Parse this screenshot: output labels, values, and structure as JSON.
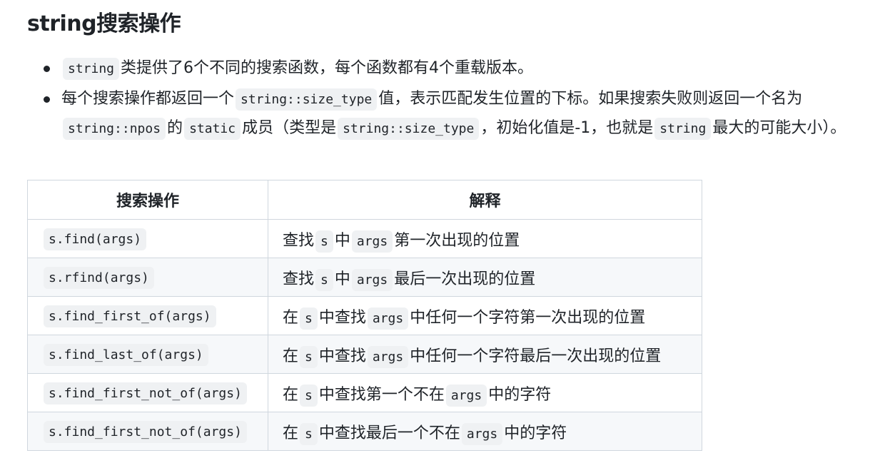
{
  "heading": "string搜索操作",
  "bullets": {
    "b1": {
      "code1": "string",
      "text1": "类提供了6个不同的搜索函数，每个函数都有4个重载版本。"
    },
    "b2": {
      "text1": "每个搜索操作都返回一个",
      "code1": "string::size_type",
      "text2": "值，表示匹配发生位置的下标。如果搜索失败则返回一个名为",
      "code2": "string::npos",
      "text3": "的",
      "code3": "static",
      "text4": "成员（类型是",
      "code4": "string::size_type",
      "text5": "，初始化值是-1，也就是",
      "code5": "string",
      "text6": "最大的可能大小）。"
    }
  },
  "table": {
    "headers": [
      "搜索操作",
      "解释"
    ],
    "rows": [
      {
        "op": "s.find(args)",
        "p1": "查找",
        "c1": "s",
        "p2": "中",
        "c2": "args",
        "p3": "第一次出现的位置"
      },
      {
        "op": "s.rfind(args)",
        "p1": "查找",
        "c1": "s",
        "p2": "中",
        "c2": "args",
        "p3": "最后一次出现的位置"
      },
      {
        "op": "s.find_first_of(args)",
        "p1": "在",
        "c1": "s",
        "p2": "中查找",
        "c2": "args",
        "p3": "中任何一个字符第一次出现的位置"
      },
      {
        "op": "s.find_last_of(args)",
        "p1": "在",
        "c1": "s",
        "p2": "中查找",
        "c2": "args",
        "p3": "中任何一个字符最后一次出现的位置"
      },
      {
        "op": "s.find_first_not_of(args)",
        "p1": "在",
        "c1": "s",
        "p2": "中查找第一个不在",
        "c2": "args",
        "p3": "中的字符"
      },
      {
        "op": "s.find_first_not_of(args)",
        "p1": "在",
        "c1": "s",
        "p2": "中查找最后一个不在",
        "c2": "args",
        "p3": "中的字符"
      }
    ]
  }
}
